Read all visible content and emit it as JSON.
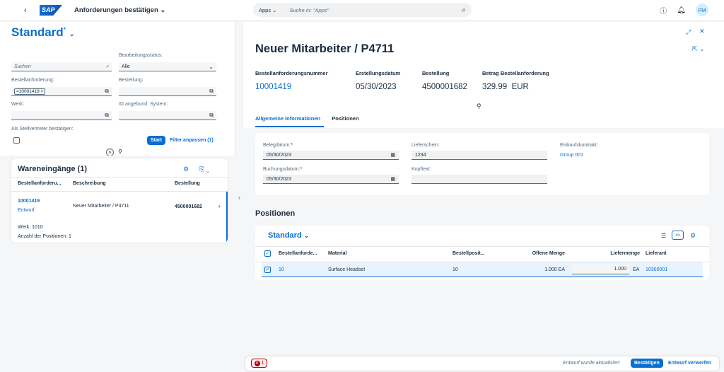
{
  "shell": {
    "back": "‹",
    "logo": "SAP",
    "app_title": "Anforderungen bestätigen",
    "search_scope": "Apps",
    "search_placeholder": "Suche in: \"Apps\"",
    "avatar": "FM"
  },
  "filterbar": {
    "variant": "Standard",
    "variant_dirty": "*",
    "search_placeholder": "Suchen",
    "status_label": "Bearbeitungsstatus:",
    "status_value": "Alle",
    "request_label": "Bestellanforderung:",
    "request_token": "=10001419",
    "order_label": "Bestellung:",
    "plant_label": "Werk:",
    "system_label": "ID angebund. System:",
    "substitute_label": "Als Stellvertreter bestätigen:",
    "start_button": "Start",
    "adapt_button": "Filter anpassen (1)"
  },
  "list": {
    "title": "Wareneingänge (1)",
    "columns": [
      "Bestellanforderu...",
      "Beschreibung",
      "Bestellung"
    ],
    "row": {
      "request": "10001419",
      "status": "Entwurf",
      "description": "Neuer Mitarbeiter / P4711",
      "order": "4500001682",
      "plant_label": "Werk:",
      "plant_value": "1010",
      "count_label": "Anzahl der Positionen:",
      "count_value": "1"
    }
  },
  "object": {
    "title": "Neuer Mitarbeiter / P4711",
    "kpis": [
      {
        "label": "Bestellanforderungsnummer",
        "value": "10001419"
      },
      {
        "label": "Erstellungsdatum",
        "value": "05/30/2023"
      },
      {
        "label": "Bestellung",
        "value": "4500001682"
      },
      {
        "label": "Betrag Bestellanforderung",
        "value": "329.99",
        "unit": "EUR"
      }
    ],
    "tabs": [
      "Allgemeine Informationen",
      "Positionen"
    ],
    "general": {
      "doc_date_label": "Belegdatum:",
      "doc_date_value": "05/30/2023",
      "post_date_label": "Buchungsdatum:",
      "post_date_value": "05/30/2023",
      "delivery_label": "Lieferschein:",
      "delivery_value": "1234",
      "header_text_label": "Kopftext:",
      "contract_label": "Einkaufskontrakt:",
      "contract_value": "Group 001"
    },
    "positions": {
      "title": "Positionen",
      "variant": "Standard",
      "columns": [
        "Bestellanforde...",
        "Material",
        "Bestellposit...",
        "Offene Menge",
        "Liefermenge",
        "Lieferant"
      ],
      "row": {
        "item": "10",
        "material": "Surface Headset",
        "po_item": "10",
        "open_qty": "1.000 EA",
        "delivery_qty": "1.000",
        "delivery_unit": "EA",
        "supplier": "10300001"
      }
    }
  },
  "footer": {
    "error_count": "1",
    "status": "Entwurf wurde aktualisiert",
    "confirm_button": "Bestätigen",
    "discard_button": "Entwurf verwerfen"
  }
}
